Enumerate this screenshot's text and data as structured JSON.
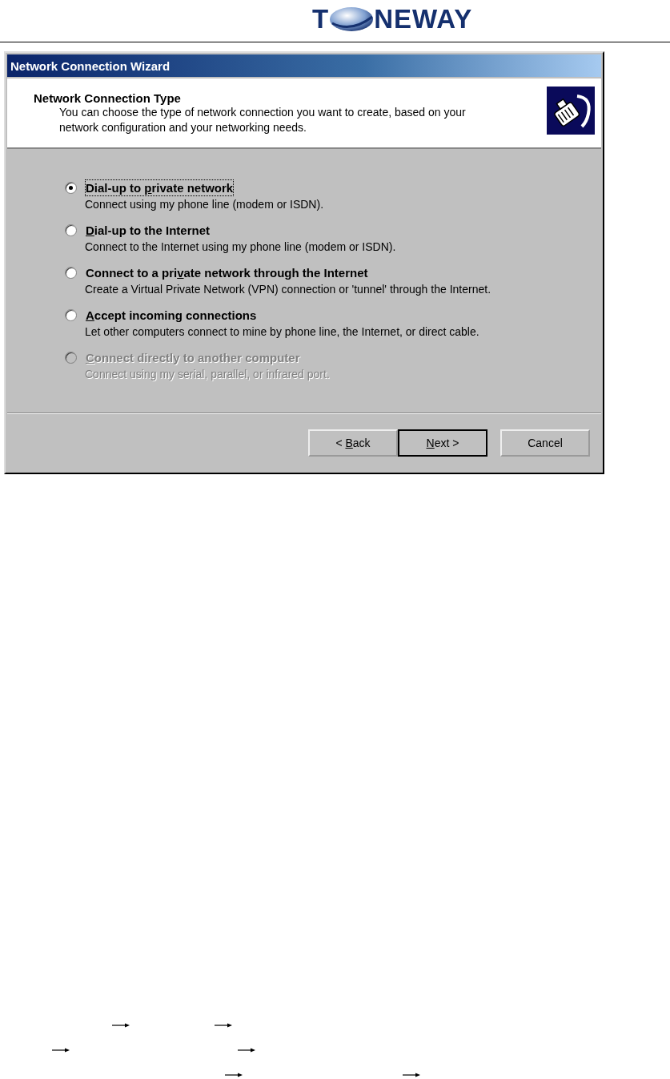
{
  "logo": {
    "left": "T",
    "right": "NEWAY"
  },
  "window": {
    "title": "Network Connection Wizard"
  },
  "header": {
    "title": "Network Connection Type",
    "description": "You can choose the type of network connection you want to create, based on your network configuration and your networking needs."
  },
  "options": [
    {
      "label": {
        "before": "Dial-up to ",
        "key": "p",
        "after": "rivate network"
      },
      "description": "Connect using my phone line (modem or ISDN).",
      "selected": true,
      "disabled": false
    },
    {
      "label": {
        "key": "D",
        "after": "ial-up to the Internet"
      },
      "description": "Connect to the Internet using my phone line (modem or ISDN).",
      "selected": false,
      "disabled": false
    },
    {
      "label": {
        "before": "Connect to a pri",
        "key": "v",
        "after": "ate network through the Internet"
      },
      "description": "Create a Virtual Private Network (VPN) connection or 'tunnel' through the Internet.",
      "selected": false,
      "disabled": false
    },
    {
      "label": {
        "key": "A",
        "after": "ccept incoming connections"
      },
      "description": "Let other computers connect to mine by phone line, the Internet, or direct cable.",
      "selected": false,
      "disabled": false
    },
    {
      "label": {
        "key": "C",
        "after": "onnect directly to another computer"
      },
      "description": "Connect using my serial, parallel, or infrared port.",
      "selected": false,
      "disabled": true
    }
  ],
  "buttons": [
    {
      "label": {
        "before": "< ",
        "key": "B",
        "after": "ack"
      },
      "default": false
    },
    {
      "label": {
        "key": "N",
        "after": "ext >"
      },
      "default": true
    },
    {
      "label": {
        "before": "Cancel"
      },
      "default": false
    }
  ]
}
